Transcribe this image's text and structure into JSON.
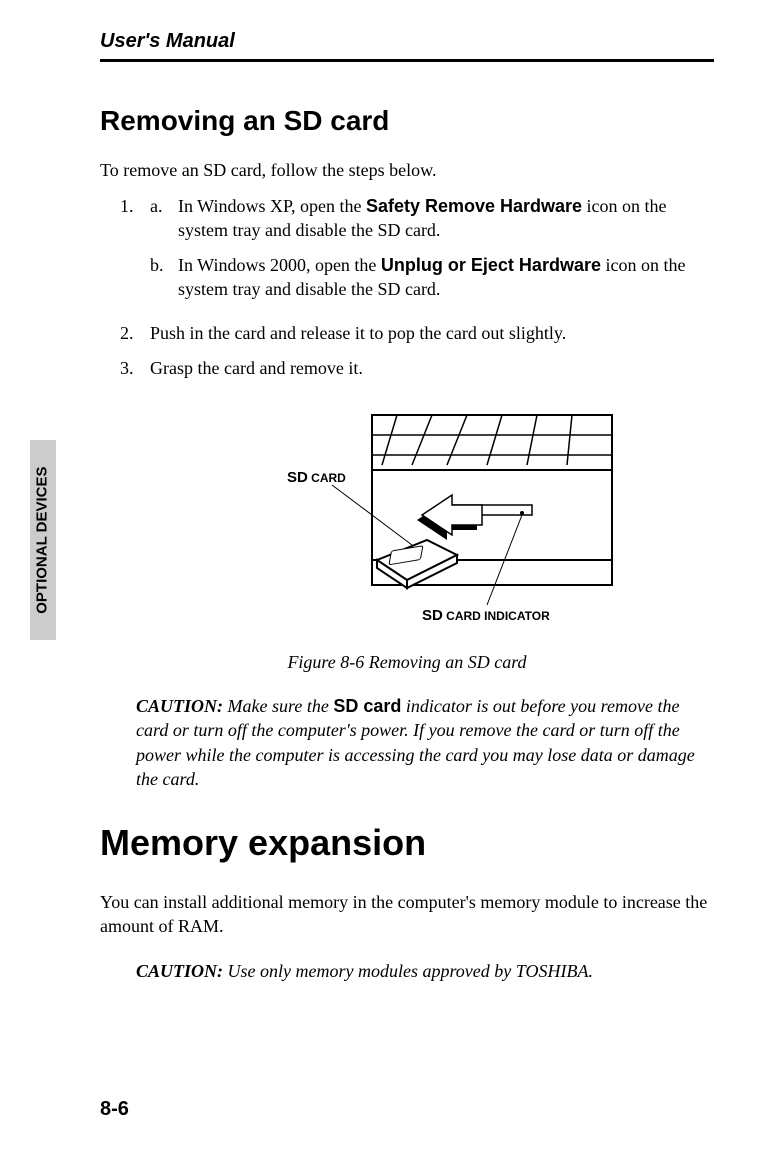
{
  "header": "User's Manual",
  "side_tab": "OPTIONAL DEVICES",
  "section1": {
    "title": "Removing an SD card",
    "intro": "To remove an SD card, follow the steps below.",
    "items": [
      {
        "num": "1.",
        "subs": [
          {
            "letter": "a.",
            "pre": "In Windows XP, open the ",
            "bold": "Safety Remove Hardware",
            "post": " icon on the system tray and disable the SD card."
          },
          {
            "letter": "b.",
            "pre": "In Windows 2000, open the ",
            "bold": "Unplug or Eject Hardware",
            "post": " icon on the system tray and disable the SD card."
          }
        ]
      },
      {
        "num": "2.",
        "text": "Push in the card and release it to pop the card out slightly."
      },
      {
        "num": "3.",
        "text": "Grasp the card and remove it."
      }
    ]
  },
  "figure": {
    "label1_a": "SD",
    "label1_b": " CARD",
    "label2_a": "SD",
    "label2_b": " CARD INDICATOR",
    "caption": "Figure 8-6  Removing an SD card"
  },
  "caution1": {
    "label": "CAUTION:",
    "pre": " Make sure the ",
    "bold": "SD card",
    "post": " indicator is out before you remove the card or turn off the computer's power. If you remove the card or turn off the power while the computer is accessing the card you may lose data or damage the card."
  },
  "section2": {
    "title": "Memory expansion",
    "intro": "You can install additional memory in the computer's memory module to increase the amount of RAM."
  },
  "caution2": {
    "label": "CAUTION:",
    "text": " Use only memory modules approved by TOSHIBA."
  },
  "page_num": "8-6"
}
